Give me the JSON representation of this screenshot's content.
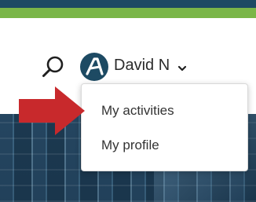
{
  "header": {
    "user": {
      "name": "David N"
    }
  },
  "dropdown": {
    "items": [
      {
        "label": "My activities"
      },
      {
        "label": "My profile"
      }
    ]
  },
  "icons": {
    "search": "search-icon",
    "avatar_logo": "letter-a-logo-icon",
    "chevron": "chevron-down-icon",
    "arrow": "red-arrow-pointer-icon"
  },
  "colors": {
    "top_bar_dark": "#1d4a63",
    "top_bar_green": "#7ab648",
    "avatar_bg": "#1d4a63",
    "arrow_red": "#c8292c"
  }
}
